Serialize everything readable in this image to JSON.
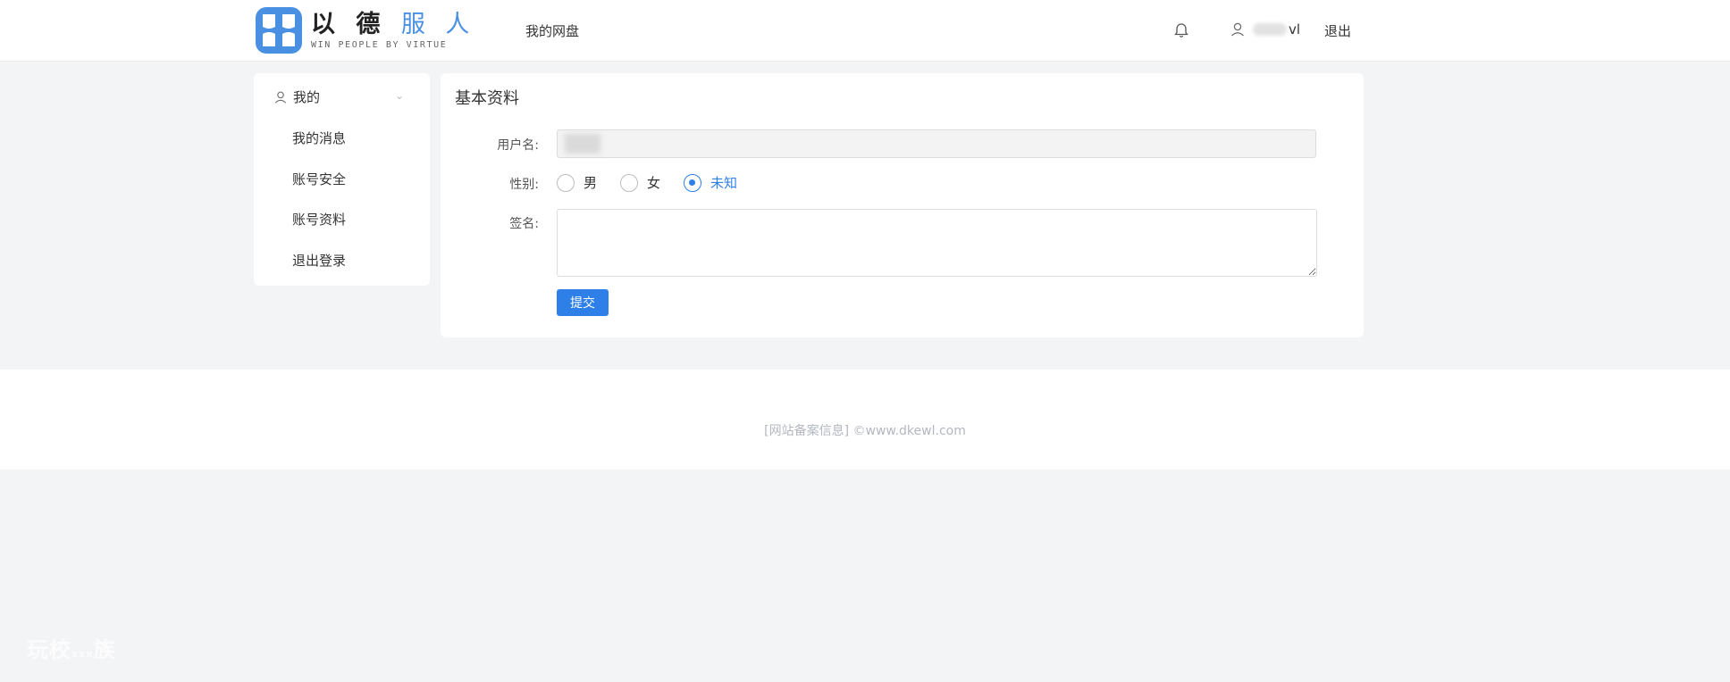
{
  "header": {
    "logo_cn_dark": "以 德",
    "logo_cn_blue": "服 人",
    "logo_en": "WIN PEOPLE BY VIRTUE",
    "nav_label": "我的网盘",
    "user_suffix": "vl",
    "logout_label": "退出",
    "icons": {
      "bell": "bell-icon",
      "user": "user-icon"
    }
  },
  "sidebar": {
    "section_label": "我的",
    "items": [
      {
        "label": "我的消息"
      },
      {
        "label": "账号安全"
      },
      {
        "label": "账号资料"
      },
      {
        "label": "退出登录"
      }
    ]
  },
  "main": {
    "title": "基本资料",
    "username_label": "用户名:",
    "gender_label": "性别:",
    "gender_options": [
      {
        "label": "男",
        "checked": false
      },
      {
        "label": "女",
        "checked": false
      },
      {
        "label": "未知",
        "checked": true
      }
    ],
    "signature_label": "签名:",
    "signature_value": "",
    "submit_label": "提交"
  },
  "footer": {
    "beian_link": "[网站备案信息]",
    "copyright": "©www.dkewl.com"
  },
  "watermark": {
    "text_main": "玩校",
    "text_small": "xxx",
    "text_end": "族"
  },
  "colors": {
    "accent": "#2e7fe8",
    "logo_blue": "#4a90e2",
    "background": "#f3f4f6"
  }
}
